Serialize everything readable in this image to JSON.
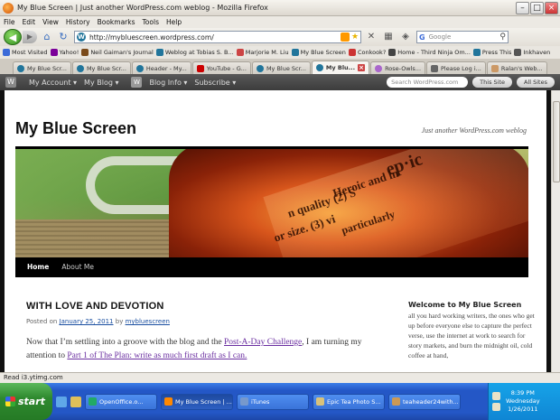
{
  "window": {
    "title": "My Blue Screen | Just another WordPress.com weblog - Mozilla Firefox"
  },
  "menubar": [
    "File",
    "Edit",
    "View",
    "History",
    "Bookmarks",
    "Tools",
    "Help"
  ],
  "navbar": {
    "url": "http://mybluescreen.wordpress.com/",
    "search_placeholder": "Google"
  },
  "bookmarks": [
    {
      "label": "Most Visited",
      "color": "#3b6ad8"
    },
    {
      "label": "Yahoo!",
      "color": "#7b0099"
    },
    {
      "label": "Neil Gaiman's Journal",
      "color": "#7a4a1a"
    },
    {
      "label": "Weblog at Tobias S. B...",
      "color": "#21759b"
    },
    {
      "label": "Marjorie M. Liu",
      "color": "#c44"
    },
    {
      "label": "My Blue Screen",
      "color": "#21759b"
    },
    {
      "label": "Conkook?",
      "color": "#c33"
    },
    {
      "label": "Home - Third Ninja Om...",
      "color": "#444"
    },
    {
      "label": "Press This",
      "color": "#21759b"
    },
    {
      "label": "Inkhaven",
      "color": "#555"
    }
  ],
  "tabs": [
    {
      "label": "My Blue Scr...",
      "active": false
    },
    {
      "label": "My Blue Scr...",
      "active": false
    },
    {
      "label": "Header - My...",
      "active": false
    },
    {
      "label": "YouTube - G...",
      "active": false
    },
    {
      "label": "My Blue Scr...",
      "active": false
    },
    {
      "label": "My Blu...",
      "active": true
    },
    {
      "label": "Rose-Owls...",
      "active": false
    },
    {
      "label": "Please Log i...",
      "active": false
    },
    {
      "label": "Ralan's Web...",
      "active": false
    }
  ],
  "wpbar": {
    "my_account": "My Account ▾",
    "my_blog": "My Blog ▾",
    "blog_info": "Blog Info ▾",
    "subscribe": "Subscribe ▾",
    "search_placeholder": "Search WordPress.com",
    "this_site": "This Site",
    "all_sites": "All Sites"
  },
  "site": {
    "title": "My Blue Screen",
    "description": "Just another WordPress.com weblog",
    "banner_words": [
      "ep·ic",
      "Heroic and in",
      "n quality (2) S",
      "or size. (3) vi",
      "particularly"
    ]
  },
  "menu": {
    "home": "Home",
    "about": "About Me"
  },
  "post": {
    "title": "WITH LOVE AND DEVOTION",
    "posted_on": "Posted on",
    "date": "January 25, 2011",
    "by": "by",
    "author": "mybluescreen",
    "body_1": "Now that I’m settling into a groove with the blog and the ",
    "link_1": "Post-A-Day Challenge",
    "body_2": ", I am turning my attention to ",
    "link_2": "Part 1 of The Plan:  write as much first draft as I can."
  },
  "sidebar": {
    "widget_title": "Welcome to My Blue Screen",
    "widget_text": "all you hard working writers, the ones who get up before everyone else to capture the perfect verse, use the internet at work to search for story markets, and burn the midnight oil, cold coffee at hand,"
  },
  "statusbar": {
    "text": "Read i3.ytimg.com"
  },
  "taskbar": {
    "start": "start",
    "tasks": [
      {
        "label": "OpenOffice.o...",
        "active": false,
        "color": "#2a6"
      },
      {
        "label": "My Blue Screen | ...",
        "active": true,
        "color": "#f80"
      },
      {
        "label": "iTunes",
        "active": false,
        "color": "#79c"
      },
      {
        "label": "Epic Tea Photo S...",
        "active": false,
        "color": "#d9c27a"
      },
      {
        "label": "teaheader24with...",
        "active": false,
        "color": "#c95"
      }
    ],
    "clock_time": "8:39 PM",
    "clock_day": "Wednesday",
    "clock_date": "1/26/2011"
  }
}
